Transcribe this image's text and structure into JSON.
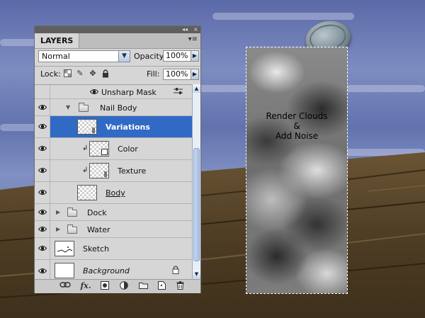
{
  "panel": {
    "tab_label": "LAYERS",
    "collapse_glyph": "◂◂",
    "close_glyph": "×",
    "menu_glyph": "▾≡"
  },
  "options": {
    "blend_mode": "Normal",
    "opacity_label": "Opacity:",
    "opacity_value": "100%",
    "lock_label": "Lock:",
    "fill_label": "Fill:",
    "fill_value": "100%"
  },
  "layers": [
    {
      "name": "Unsharp Mask",
      "kind": "filter-effect"
    },
    {
      "name": "Nail Body",
      "kind": "group-open"
    },
    {
      "name": "Variations",
      "kind": "layer",
      "selected": true
    },
    {
      "name": "Color",
      "kind": "clipped-layer"
    },
    {
      "name": "Texture",
      "kind": "clipped-layer"
    },
    {
      "name": "Body",
      "kind": "layer"
    },
    {
      "name": "Dock",
      "kind": "group-closed"
    },
    {
      "name": "Water",
      "kind": "group-closed"
    },
    {
      "name": "Sketch",
      "kind": "layer"
    },
    {
      "name": "Background",
      "kind": "background-locked"
    }
  ],
  "canvas": {
    "annotation_line1": "Render Clouds",
    "annotation_line2": "&",
    "annotation_line3": "Add Noise"
  },
  "icons": {
    "visibility": "eye-icon",
    "lock_transparency": "checker-lock-icon",
    "lock_pixels": "brush-lock-icon",
    "lock_position": "move-lock-icon",
    "lock_all": "padlock-icon",
    "link": "link-icon",
    "fx": "fx-icon",
    "mask": "mask-icon",
    "adjustment": "adjustment-icon",
    "new_group": "folder-icon",
    "new_layer": "new-layer-icon",
    "trash": "trash-icon"
  },
  "colors": {
    "selection": "#316ac5",
    "panel_bg": "#d6d6d6"
  }
}
